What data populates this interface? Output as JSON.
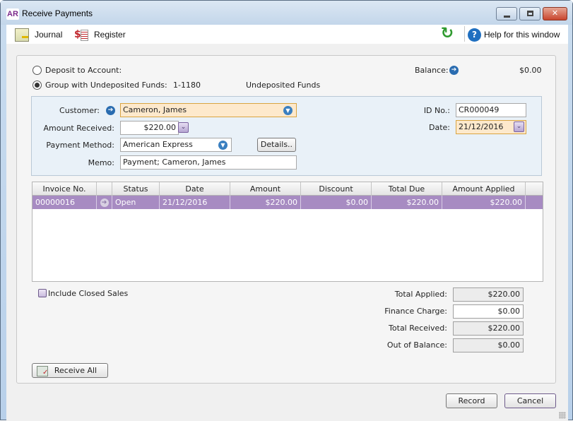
{
  "window": {
    "app_badge": "AR",
    "title": "Receive Payments",
    "controls": {
      "minimize": "minimize",
      "maximize": "maximize",
      "close": "✕"
    }
  },
  "toolbar": {
    "journal_label": "Journal",
    "register_label": "Register",
    "refresh_glyph": "↻",
    "help_glyph": "?",
    "help_label": "Help for this window"
  },
  "deposit": {
    "option_deposit_label": "Deposit to Account:",
    "option_group_label": "Group with Undeposited Funds:",
    "selected": "group",
    "account_number": "1-1180",
    "account_name": "Undeposited Funds",
    "balance_label": "Balance:",
    "balance_value": "$0.00"
  },
  "form": {
    "customer_label": "Customer:",
    "customer_value": "Cameron, James",
    "amount_label": "Amount Received:",
    "amount_value": "$220.00",
    "payment_method_label": "Payment Method:",
    "payment_method_value": "American Express",
    "details_button": "Details..",
    "memo_label": "Memo:",
    "memo_value": "Payment; Cameron, James",
    "id_label": "ID No.:",
    "id_value": "CR000049",
    "date_label": "Date:",
    "date_value": "21/12/2016"
  },
  "table": {
    "columns": [
      "Invoice No.",
      "",
      "Status",
      "Date",
      "Amount",
      "Discount",
      "Total Due",
      "Amount Applied"
    ],
    "rows": [
      {
        "invoice_no": "00000016",
        "status": "Open",
        "date": "21/12/2016",
        "amount": "$220.00",
        "discount": "$0.00",
        "total_due": "$220.00",
        "amount_applied": "$220.00"
      }
    ]
  },
  "include_closed_sales": {
    "label": "Include Closed Sales",
    "checked": false
  },
  "summary": {
    "total_applied_label": "Total Applied:",
    "total_applied_value": "$220.00",
    "finance_charge_label": "Finance Charge:",
    "finance_charge_value": "$0.00",
    "total_received_label": "Total Received:",
    "total_received_value": "$220.00",
    "out_of_balance_label": "Out of Balance:",
    "out_of_balance_value": "$0.00"
  },
  "buttons": {
    "receive_all": "Receive All",
    "record": "Record",
    "cancel": "Cancel"
  },
  "colors": {
    "selected_row": "#a78bc2",
    "highlight_field": "#fde9cc",
    "accent_blue": "#2a6cb0"
  }
}
